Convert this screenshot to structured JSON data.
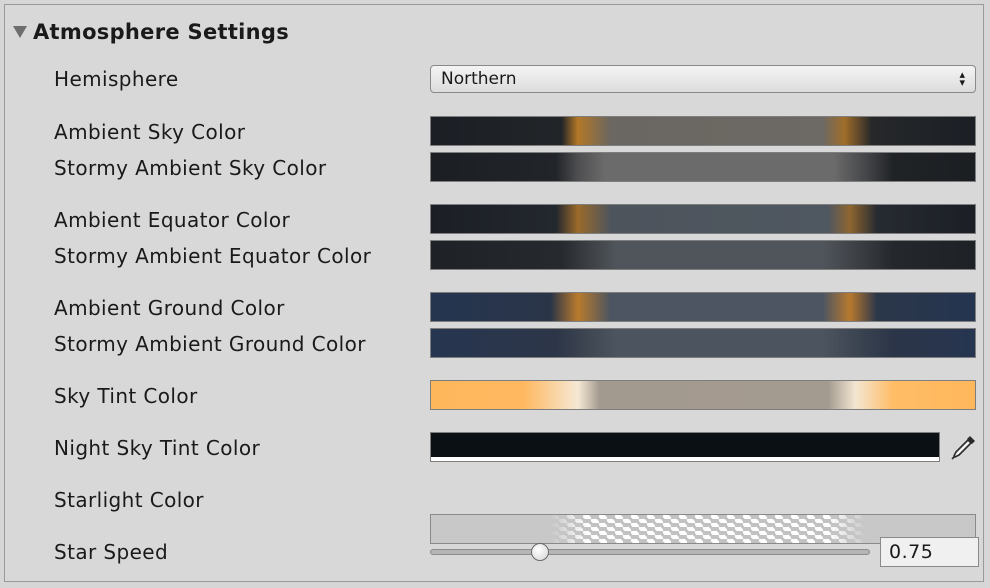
{
  "section": {
    "title": "Atmosphere Settings"
  },
  "fields": {
    "hemisphere": {
      "label": "Hemisphere",
      "value": "Northern"
    },
    "ambient_sky": {
      "label": "Ambient Sky Color"
    },
    "stormy_ambient_sky": {
      "label": "Stormy Ambient Sky Color"
    },
    "ambient_equator": {
      "label": "Ambient Equator Color"
    },
    "stormy_ambient_equator": {
      "label": "Stormy Ambient Equator Color"
    },
    "ambient_ground": {
      "label": "Ambient Ground Color"
    },
    "stormy_ambient_ground": {
      "label": "Stormy Ambient Ground Color"
    },
    "sky_tint": {
      "label": "Sky Tint Color"
    },
    "night_sky_tint": {
      "label": "Night Sky Tint Color",
      "color": "#0b1015",
      "icon": "eyedropper-icon"
    },
    "starlight": {
      "label": "Starlight Color"
    },
    "star_speed": {
      "label": "Star Speed",
      "value": "0.75",
      "slider_fraction": 0.25
    }
  }
}
